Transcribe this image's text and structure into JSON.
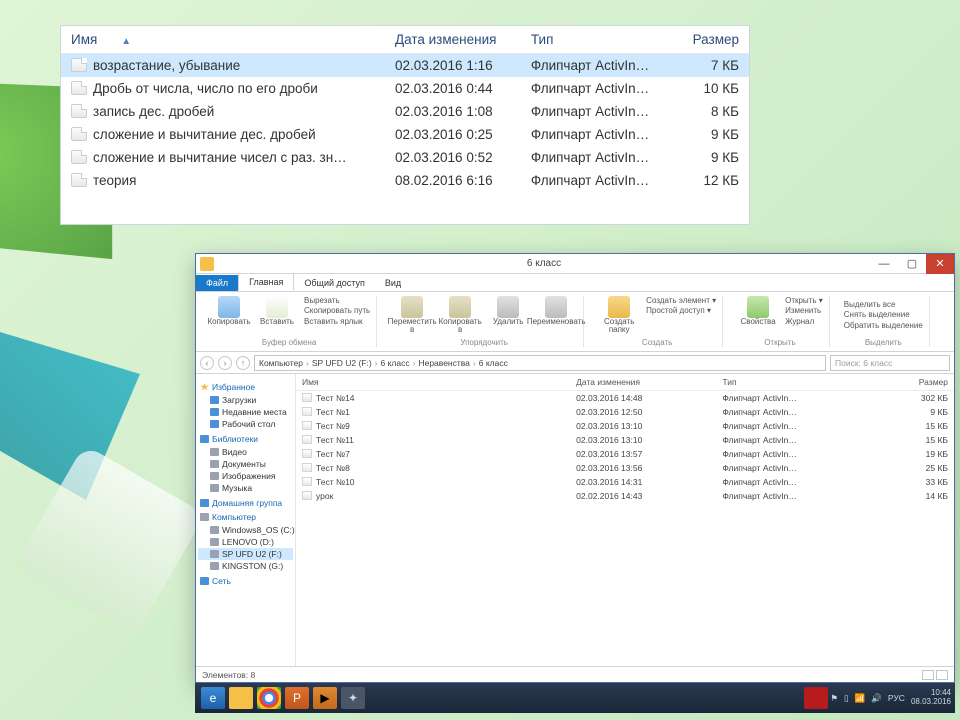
{
  "top": {
    "headers": {
      "name": "Имя",
      "date": "Дата изменения",
      "type": "Тип",
      "size": "Размер",
      "sort": "▲"
    },
    "rows": [
      {
        "name": "возрастание, убывание",
        "date": "02.03.2016 1:16",
        "type": "Флипчарт ActivIn…",
        "size": "7 КБ",
        "selected": true
      },
      {
        "name": "Дробь от числа, число по его дроби",
        "date": "02.03.2016 0:44",
        "type": "Флипчарт ActivIn…",
        "size": "10 КБ"
      },
      {
        "name": "запись дес. дробей",
        "date": "02.03.2016 1:08",
        "type": "Флипчарт ActivIn…",
        "size": "8 КБ"
      },
      {
        "name": "сложение и вычитание дес. дробей",
        "date": "02.03.2016 0:25",
        "type": "Флипчарт ActivIn…",
        "size": "9 КБ"
      },
      {
        "name": "сложение и вычитание чисел с раз. зн…",
        "date": "02.03.2016 0:52",
        "type": "Флипчарт ActivIn…",
        "size": "9 КБ"
      },
      {
        "name": "теория",
        "date": "08.02.2016 6:16",
        "type": "Флипчарт ActivIn…",
        "size": "12 КБ"
      }
    ]
  },
  "win": {
    "title": "6 класс",
    "min": "—",
    "max": "▢",
    "close": "✕",
    "tabs": {
      "file": "Файл",
      "home": "Главная",
      "share": "Общий доступ",
      "view": "Вид"
    },
    "ribbon": {
      "g1": {
        "big1": "Копировать",
        "big2": "Вставить",
        "s1": "Вырезать",
        "s2": "Скопировать путь",
        "s3": "Вставить ярлык",
        "label": "Буфер обмена"
      },
      "g2": {
        "b1": "Переместить в",
        "b2": "Копировать в",
        "b3": "Удалить",
        "b4": "Переименовать",
        "label": "Упорядочить"
      },
      "g3": {
        "b1": "Создать папку",
        "s1": "Создать элемент ▾",
        "s2": "Простой доступ ▾",
        "label": "Создать"
      },
      "g4": {
        "b1": "Свойства",
        "s1": "Открыть ▾",
        "s2": "Изменить",
        "s3": "Журнал",
        "label": "Открыть"
      },
      "g5": {
        "s1": "Выделить все",
        "s2": "Снять выделение",
        "s3": "Обратить выделение",
        "label": "Выделить"
      }
    },
    "breadcrumbs": [
      "Компьютер",
      "SP UFD U2 (F:)",
      "6 класс",
      "Неравенства",
      "6 класс"
    ],
    "search_ph": "Поиск: 6 класс",
    "tree": {
      "fav": "Избранное",
      "fav1": "Загрузки",
      "fav2": "Недавние места",
      "fav3": "Рабочий стол",
      "lib": "Библиотеки",
      "lib1": "Видео",
      "lib2": "Документы",
      "lib3": "Изображения",
      "lib4": "Музыка",
      "hg": "Домашняя группа",
      "pc": "Компьютер",
      "pc1": "Windows8_OS (C:)",
      "pc2": "LENOVO (D:)",
      "pc3": "SP UFD U2 (F:)",
      "pc4": "KINGSTON (G:)",
      "net": "Сеть"
    },
    "list": {
      "headers": {
        "name": "Имя",
        "date": "Дата изменения",
        "type": "Тип",
        "size": "Размер"
      },
      "rows": [
        {
          "name": "Тест №14",
          "date": "02.03.2016 14:48",
          "type": "Флипчарт ActivIn…",
          "size": "302 КБ"
        },
        {
          "name": "Тест №1",
          "date": "02.03.2016 12:50",
          "type": "Флипчарт ActivIn…",
          "size": "9 КБ"
        },
        {
          "name": "Тест №9",
          "date": "02.03.2016 13:10",
          "type": "Флипчарт ActivIn…",
          "size": "15 КБ"
        },
        {
          "name": "Тест №11",
          "date": "02.03.2016 13:10",
          "type": "Флипчарт ActivIn…",
          "size": "15 КБ"
        },
        {
          "name": "Тест №7",
          "date": "02.03.2016 13:57",
          "type": "Флипчарт ActivIn…",
          "size": "19 КБ"
        },
        {
          "name": "Тест №8",
          "date": "02.03.2016 13:56",
          "type": "Флипчарт ActivIn…",
          "size": "25 КБ"
        },
        {
          "name": "Тест №10",
          "date": "02.03.2016 14:31",
          "type": "Флипчарт ActivIn…",
          "size": "33 КБ"
        },
        {
          "name": "урок",
          "date": "02.02.2016 14:43",
          "type": "Флипчарт ActivIn…",
          "size": "14 КБ"
        }
      ]
    },
    "status": "Элементов: 8"
  },
  "taskbar": {
    "lang": "РУС",
    "time": "10:44",
    "date": "08.03.2016"
  }
}
